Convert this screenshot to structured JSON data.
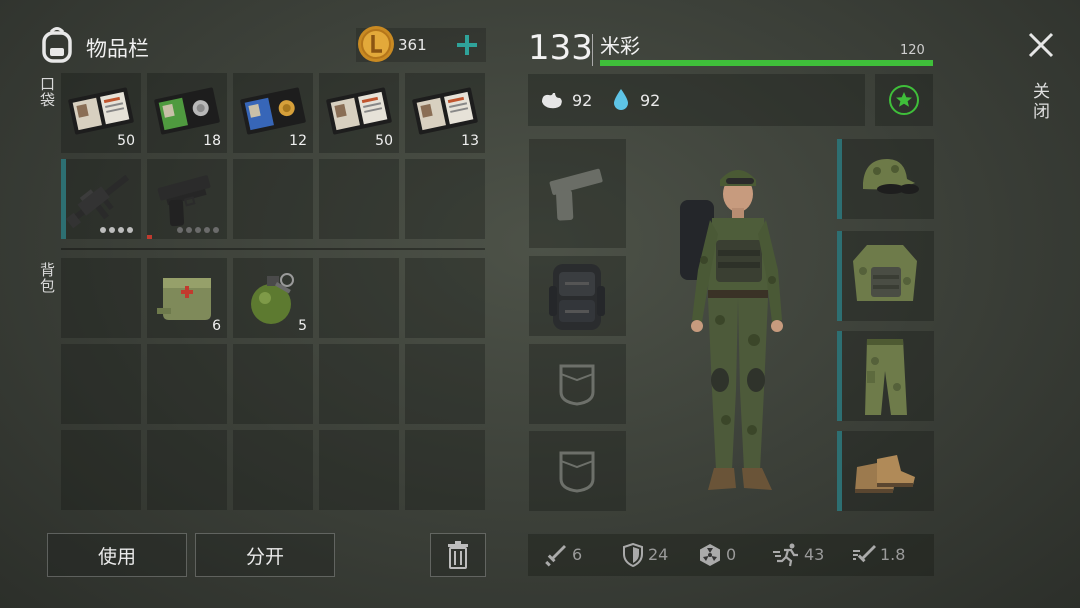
{
  "inventory": {
    "title": "物品栏",
    "coins": "361",
    "pocket_label": "口袋",
    "backpack_label": "背包",
    "pocket_items": [
      {
        "name": "id-card-red",
        "count": "50"
      },
      {
        "name": "id-card-green",
        "count": "18"
      },
      {
        "name": "id-card-blue",
        "count": "12"
      },
      {
        "name": "id-card-red",
        "count": "50"
      },
      {
        "name": "id-card-red",
        "count": "13"
      },
      {
        "name": "assault-rifle",
        "count": ""
      },
      {
        "name": "pistol",
        "count": ""
      }
    ],
    "backpack_items": [
      {
        "name": "first-aid-kit",
        "count": "6"
      },
      {
        "name": "grenade",
        "count": "5"
      }
    ],
    "use_button": "使用",
    "split_button": "分开"
  },
  "character": {
    "level": "133",
    "name": "米彩",
    "hp_max": "120",
    "hp_fraction": 1.0,
    "food": "92",
    "water": "92"
  },
  "stats": {
    "attack": "6",
    "armor": "24",
    "radiation": "0",
    "speed": "43",
    "attack_speed": "1.8"
  },
  "close_label": "关闭",
  "colors": {
    "hp_green": "#3fbf3a",
    "accent_teal": "#2fa39a",
    "star_green": "#3fbf3a"
  }
}
